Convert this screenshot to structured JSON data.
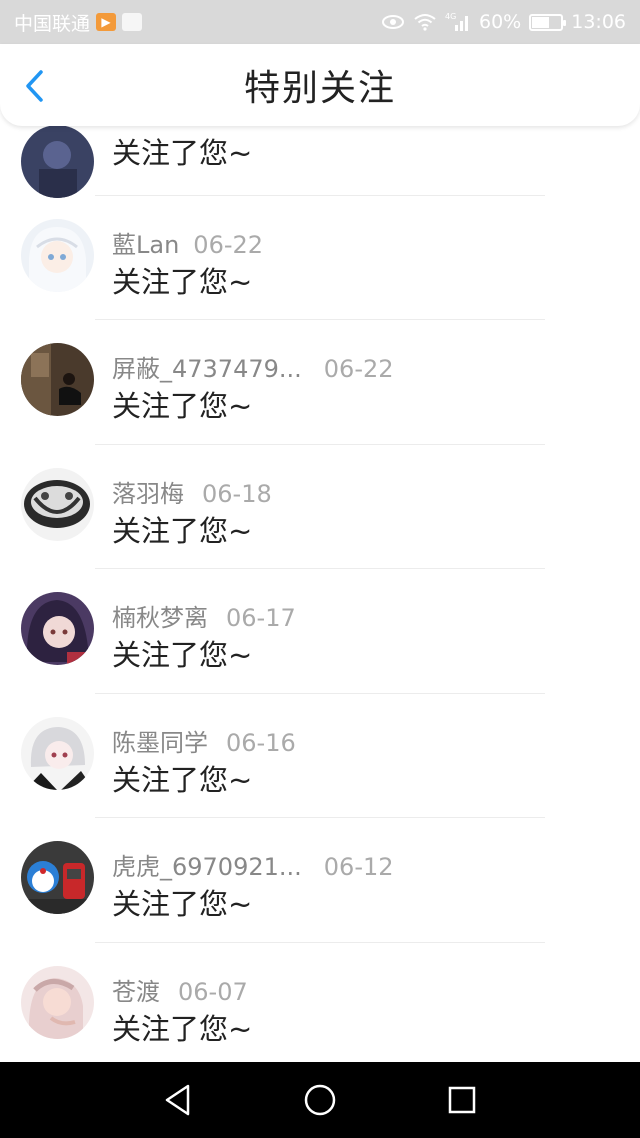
{
  "status_bar": {
    "carrier": "中国联通",
    "network": "4G",
    "battery": "60%",
    "battery_level": 0.6,
    "time": "13:06",
    "icons": [
      "video-app-icon",
      "app-icon",
      "eye-icon",
      "wifi-icon",
      "signal-icon",
      "battery-icon"
    ]
  },
  "header": {
    "title": "特别关注",
    "back_icon": "chevron-left-icon",
    "accent_color": "#2196F3"
  },
  "items": [
    {
      "name": "",
      "date": "",
      "message": "关注了您~"
    },
    {
      "name": "藍Lan",
      "date": "06-22",
      "message": "关注了您~"
    },
    {
      "name": "屏蔽_4737479...",
      "date": "06-22",
      "message": "关注了您~"
    },
    {
      "name": "落羽梅",
      "date": "06-18",
      "message": "关注了您~"
    },
    {
      "name": "楠秋梦离",
      "date": "06-17",
      "message": "关注了您~"
    },
    {
      "name": "陈墨同学",
      "date": "06-16",
      "message": "关注了您~"
    },
    {
      "name": "虎虎_6970921...",
      "date": "06-12",
      "message": "关注了您~"
    },
    {
      "name": "苍渡",
      "date": "06-07",
      "message": "关注了您~"
    }
  ],
  "nav_bar": {
    "back": "triangle-back-icon",
    "home": "circle-home-icon",
    "recents": "square-recents-icon"
  }
}
